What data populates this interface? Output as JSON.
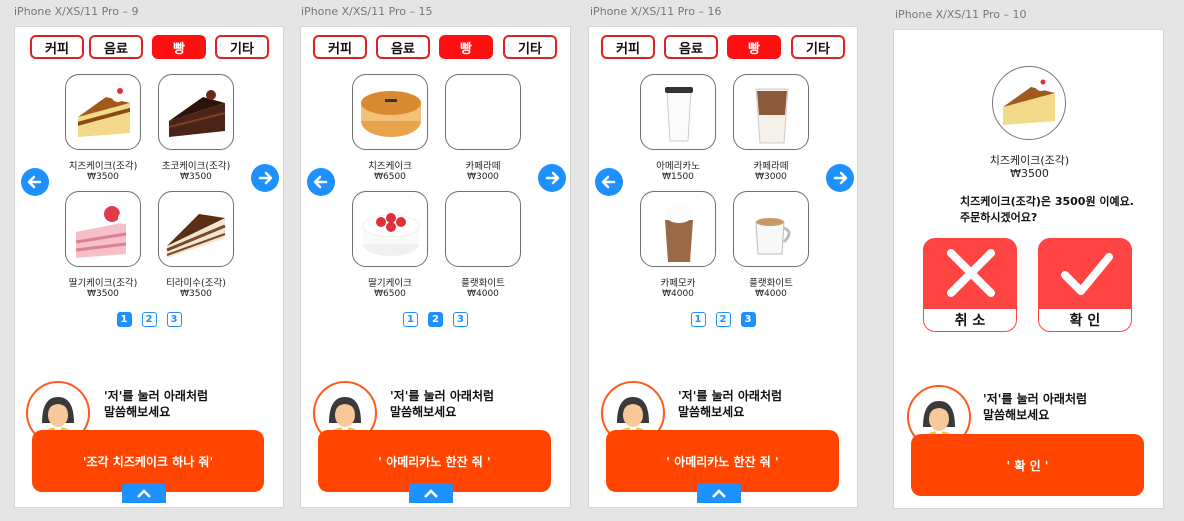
{
  "colors": {
    "accent_red": "#ff1010",
    "accent_orange": "#ff4500",
    "accent_blue": "#1e90ff"
  },
  "tabs": [
    "커피",
    "음료",
    "빵",
    "기타"
  ],
  "hint": {
    "line1": "'저'를 눌러 아래처럼",
    "line2": "말씀해보세요"
  },
  "screens": [
    {
      "title": "iPhone X/XS/11 Pro – 9",
      "active_tab": "빵",
      "products": [
        {
          "name": "치즈케이크(조각)",
          "price": "₩3500",
          "image": "cheesecake-slice"
        },
        {
          "name": "초코케이크(조각)",
          "price": "₩3500",
          "image": "chocolate-cake-slice"
        },
        {
          "name": "딸기케이크(조각)",
          "price": "₩3500",
          "image": "strawberry-cake-slice"
        },
        {
          "name": "티라미수(조각)",
          "price": "₩3500",
          "image": "tiramisu-slice"
        }
      ],
      "pages": [
        "1",
        "2",
        "3"
      ],
      "current_page": "1",
      "speech": "'조각 치즈케이크 하나 줘'"
    },
    {
      "title": "iPhone X/XS/11 Pro – 15",
      "active_tab": "빵",
      "products": [
        {
          "name": "치즈케이크",
          "price": "₩6500",
          "image": "whole-cheesecake"
        },
        {
          "name": "카페라떼",
          "price": "₩3000",
          "image": "empty"
        },
        {
          "name": "딸기케이크",
          "price": "₩6500",
          "image": "whole-strawberry-cake"
        },
        {
          "name": "플랫화이트",
          "price": "₩4000",
          "image": "empty"
        }
      ],
      "pages": [
        "1",
        "2",
        "3"
      ],
      "current_page": "2",
      "speech": "' 아메리카노 한잔 줘 '"
    },
    {
      "title": "iPhone X/XS/11 Pro – 16",
      "active_tab": "빵",
      "products": [
        {
          "name": "아메리카노",
          "price": "₩1500",
          "image": "americano-cup"
        },
        {
          "name": "카페라떼",
          "price": "₩3000",
          "image": "iced-latte"
        },
        {
          "name": "카페모카",
          "price": "₩4000",
          "image": "cafe-mocha"
        },
        {
          "name": "플랫화이트",
          "price": "₩4000",
          "image": "flat-white"
        }
      ],
      "pages": [
        "1",
        "2",
        "3"
      ],
      "current_page": "3",
      "speech": "' 아메리카노 한잔 줘 '"
    }
  ],
  "confirm_screen": {
    "title": "iPhone X/XS/11 Pro – 10",
    "product_name": "치즈케이크(조각)",
    "price": "₩3500",
    "message_line1": "치즈케이크(조각)은 3500원 이예요.",
    "message_line2": "주문하시겠어요?",
    "cancel_label": "취 소",
    "ok_label": "확 인",
    "speech": "' 확 인 '"
  }
}
